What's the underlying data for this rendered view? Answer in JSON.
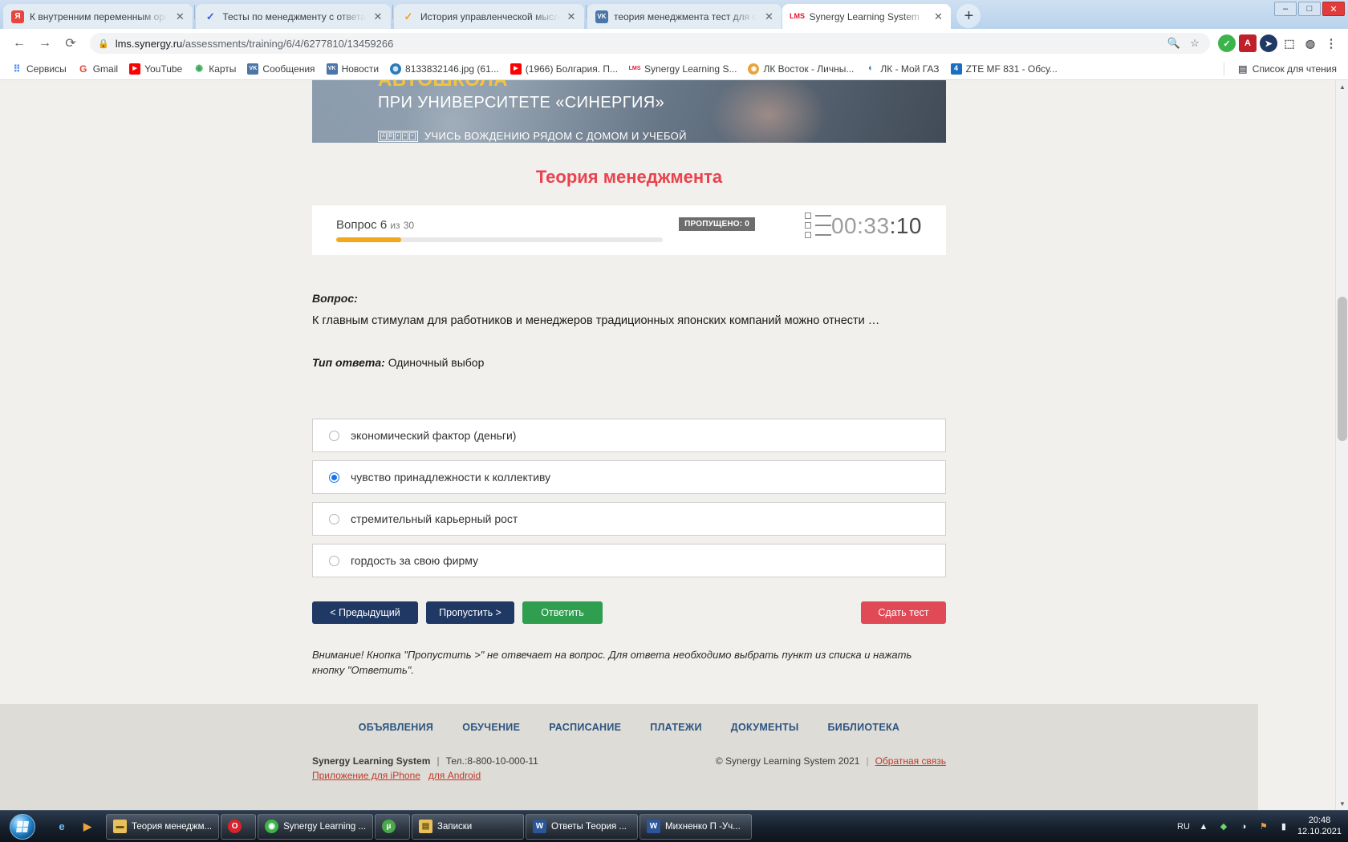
{
  "window": {
    "minimize": "–",
    "maximize": "□",
    "close": "✕"
  },
  "browser": {
    "tabs": [
      {
        "title": "К внутренним переменным орг",
        "favicon": "yandex-icon",
        "favicon_text": "Я",
        "favicon_color": "#e8453c",
        "active": false
      },
      {
        "title": "Тесты по менеджменту с ответа",
        "favicon": "checkmark-icon",
        "favicon_text": "✓",
        "favicon_color": "#3b5bdb",
        "active": false
      },
      {
        "title": "История управленческой мысл",
        "favicon": "check-orange-icon",
        "favicon_text": "✓",
        "favicon_color": "#f0a030",
        "active": false
      },
      {
        "title": "теория менеджмента тест для с",
        "favicon": "vk-icon",
        "favicon_text": "VK",
        "favicon_color": "#4a76a8",
        "active": false
      },
      {
        "title": "Synergy Learning System",
        "favicon": "lms-icon",
        "favicon_text": "LMS",
        "favicon_color": "#e8142d",
        "active": true
      }
    ],
    "new_tab_label": "+",
    "nav": {
      "back": "←",
      "forward": "→",
      "reload": "⟳"
    },
    "omnibox": {
      "lock": "🔒",
      "url_host": "lms.synergy.ru",
      "url_path": "/assessments/training/6/4/6277810/13459266",
      "zoom_icon": "🔍",
      "bookmark_icon": "☆"
    },
    "extensions": [
      {
        "name": "adblock-check-icon",
        "glyph": "✓",
        "color": "#3cb44b"
      },
      {
        "name": "pdf-icon",
        "glyph": "A",
        "color": "#c0202a"
      },
      {
        "name": "cursor-extension-icon",
        "glyph": "➤",
        "color": "#1f3864"
      },
      {
        "name": "puzzle-extension-icon",
        "glyph": "🧩",
        "color": "#ffffff"
      },
      {
        "name": "profile-avatar-icon",
        "glyph": "👤",
        "color": "#ffffff"
      },
      {
        "name": "chrome-menu-icon",
        "glyph": "⋮",
        "color": "#ffffff"
      }
    ],
    "bookmarks": [
      {
        "label": "Сервисы",
        "icon": "apps-grid-icon",
        "glyph": "⠿",
        "color": "#4285f4"
      },
      {
        "label": "Gmail",
        "icon": "gmail-icon",
        "glyph": "G",
        "color": "#ffffff"
      },
      {
        "label": "YouTube",
        "icon": "youtube-icon",
        "glyph": "▶",
        "color": "#ff0000"
      },
      {
        "label": "Карты",
        "icon": "maps-pin-icon",
        "glyph": "📍",
        "color": "#ffffff"
      },
      {
        "label": "Сообщения",
        "icon": "vk-icon",
        "glyph": "VK",
        "color": "#4a76a8"
      },
      {
        "label": "Новости",
        "icon": "vk-icon",
        "glyph": "VK",
        "color": "#4a76a8"
      },
      {
        "label": "8133832146.jpg (61...",
        "icon": "globe-icon",
        "glyph": "🌐",
        "color": "#2b7bb9"
      },
      {
        "label": "(1966) Болгария. П...",
        "icon": "youtube-icon",
        "glyph": "▶",
        "color": "#ff0000"
      },
      {
        "label": "Synergy Learning S...",
        "icon": "lms-icon",
        "glyph": "LMS",
        "color": "#e8142d"
      },
      {
        "label": "ЛК Восток - Личны...",
        "icon": "vostok-icon",
        "glyph": "◉",
        "color": "#e8a33d"
      },
      {
        "label": "ЛК - Мой ГАЗ",
        "icon": "gas-flame-icon",
        "glyph": "🔵",
        "color": "#2b7bb9"
      },
      {
        "label": "ZTE MF 831 - Обсу...",
        "icon": "zte-icon",
        "glyph": "4",
        "color": "#1a6fc4"
      }
    ],
    "reading_list": {
      "label": "Список для чтения",
      "icon": "reading-list-icon",
      "glyph": "▤"
    }
  },
  "banner": {
    "line1": "АВТОШКОЛА",
    "line2": "ПРИ УНИВЕРСИТЕТЕ «СИНЕРГИЯ»",
    "line3": "УЧИСЬ ВОЖДЕНИЮ РЯДОМ С ДОМОМ И УЧЕБОЙ",
    "plate_chars": [
      "А",
      "В",
      "•",
      "•",
      "•"
    ]
  },
  "course": {
    "title": "Теория менеджмента",
    "title_color": "#e8434f"
  },
  "progress": {
    "question_word": "Вопрос",
    "question_number": "6",
    "of_word": "из",
    "total": "30",
    "percent": 20,
    "skipped_badge": "ПРОПУЩЕНО: 0",
    "list_icon": "question-list-icon",
    "timer_main": "00:33",
    "timer_seconds": ":10",
    "timer_full": "00:33:10",
    "accent_color": "#f2a71c"
  },
  "question": {
    "label": "Вопрос:",
    "text": "К главным стимулам для работников и менеджеров традиционных японских компаний можно отнести …",
    "type_label": "Тип ответа:",
    "type_value": "Одиночный выбор"
  },
  "options": [
    {
      "label": "экономический фактор (деньги)",
      "selected": false
    },
    {
      "label": "чувство принадлежности к коллективу",
      "selected": true
    },
    {
      "label": "стремительный карьерный рост",
      "selected": false
    },
    {
      "label": "гордость за свою фирму",
      "selected": false
    }
  ],
  "buttons": {
    "previous": "< Предыдущий",
    "skip": "Пропустить >",
    "answer": "Ответить",
    "submit": "Сдать тест",
    "previous_color": "#1f3864",
    "skip_color": "#1f3864",
    "answer_color": "#2f9e4f",
    "submit_color": "#e04a57"
  },
  "note": "Внимание! Кнопка \"Пропустить >\" не отвечает на вопрос. Для ответа необходимо выбрать пункт из списка и нажать кнопку \"Ответить\".",
  "footer": {
    "nav": [
      "ОБЪЯВЛЕНИЯ",
      "ОБУЧЕНИЕ",
      "РАСПИСАНИЕ",
      "ПЛАТЕЖИ",
      "ДОКУМЕНТЫ",
      "БИБЛИОТЕКА"
    ],
    "brand": "Synergy Learning System",
    "phone": "Тел.:8-800-10-000-11",
    "link_iphone": "Приложение для iPhone",
    "link_android": "для Android",
    "copyright": "© Synergy Learning System 2021",
    "feedback": "Обратная связь"
  },
  "taskbar": {
    "start_icon": "windows-start-orb",
    "quick_launch": [
      {
        "name": "ie-icon",
        "glyph": "e",
        "color": "#1e6bb8"
      },
      {
        "name": "media-player-icon",
        "glyph": "▶",
        "color": "#e8a33d"
      }
    ],
    "items": [
      {
        "label": "Теория менеджм...",
        "icon": "folder-icon",
        "glyph": "📁",
        "color": "#e8c15a"
      },
      {
        "label": "",
        "icon": "opera-icon",
        "glyph": "O",
        "color": "#d8232a"
      },
      {
        "label": "Synergy Learning ...",
        "icon": "chrome-icon",
        "glyph": "◉",
        "color": "#3cb44b"
      },
      {
        "label": "",
        "icon": "utorrent-icon",
        "glyph": "µ",
        "color": "#4aa84a"
      },
      {
        "label": "Записки",
        "icon": "notes-icon",
        "glyph": "📒",
        "color": "#e8c15a"
      },
      {
        "label": "Ответы Теория ...",
        "icon": "word-icon",
        "glyph": "W",
        "color": "#2b579a"
      },
      {
        "label": "Михненко П -Уч...",
        "icon": "word-icon",
        "glyph": "W",
        "color": "#2b579a"
      }
    ],
    "tray": {
      "language": "RU",
      "icons": [
        {
          "name": "show-hidden-icons",
          "glyph": "▲"
        },
        {
          "name": "antivirus-shield-icon",
          "glyph": "🛡"
        },
        {
          "name": "volume-icon",
          "glyph": "🔊"
        },
        {
          "name": "flag-icon",
          "glyph": "⚑"
        },
        {
          "name": "network-icon",
          "glyph": "▮"
        }
      ],
      "time": "20:48",
      "date": "12.10.2021"
    }
  }
}
